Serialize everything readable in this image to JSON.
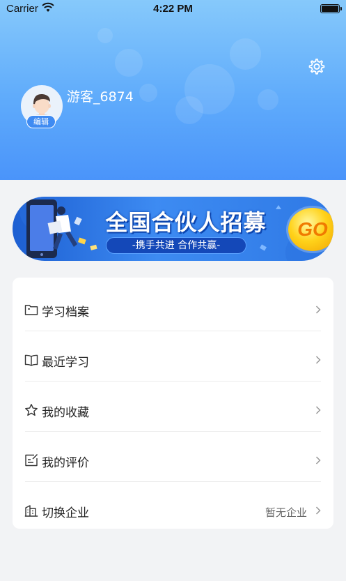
{
  "status_bar": {
    "carrier": "Carrier",
    "time": "4:22 PM"
  },
  "profile": {
    "username": "游客_6874",
    "edit_label": "编辑"
  },
  "banner": {
    "title": "全国合伙人招募",
    "subtitle": "-携手共进 合作共赢-",
    "go_label": "GO"
  },
  "menu": {
    "items": [
      {
        "label": "学习档案",
        "icon": "folder-icon",
        "value": ""
      },
      {
        "label": "最近学习",
        "icon": "book-icon",
        "value": ""
      },
      {
        "label": "我的收藏",
        "icon": "star-icon",
        "value": ""
      },
      {
        "label": "我的评价",
        "icon": "comment-edit-icon",
        "value": ""
      },
      {
        "label": "切换企业",
        "icon": "building-icon",
        "value": "暂无企业"
      }
    ]
  },
  "colors": {
    "header_top": "#86c9fb",
    "header_bottom": "#4a94fa",
    "accent": "#3f8bf2",
    "background": "#f2f3f5"
  }
}
